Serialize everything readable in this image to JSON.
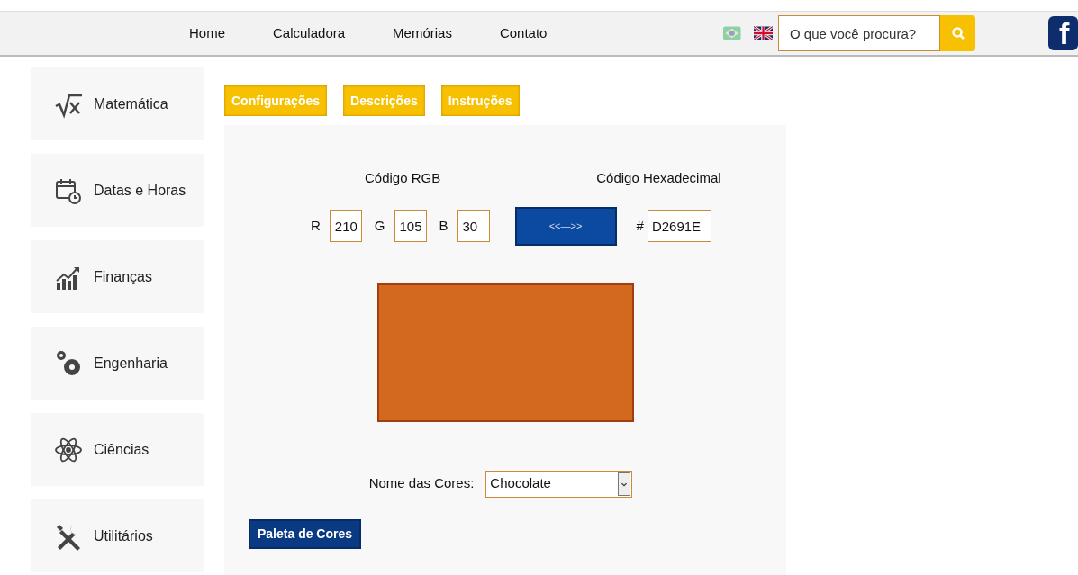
{
  "nav": {
    "links": [
      "Home",
      "Calculadora",
      "Memórias",
      "Contato"
    ],
    "search": {
      "placeholder": "O que você procura?"
    },
    "facebook": "f"
  },
  "sidebar": {
    "items": [
      "Matemática",
      "Datas e Horas",
      "Finanças",
      "Engenharia",
      "Ciências",
      "Utilitários"
    ]
  },
  "tabs": [
    "Configurações",
    "Descrições",
    "Instruções"
  ],
  "converter": {
    "rgb_title": "Código RGB",
    "hex_title": "Código Hexadecimal",
    "channels": [
      {
        "label": "R",
        "value": "210"
      },
      {
        "label": "G",
        "value": "105"
      },
      {
        "label": "B",
        "value": "30"
      }
    ],
    "swap_button": "<<—>>",
    "hex_prefix": "#",
    "hex_value": "D2691E",
    "name_label": "Nome das Cores:",
    "name_value": "Chocolate"
  },
  "palette_button": "Paleta de Cores"
}
